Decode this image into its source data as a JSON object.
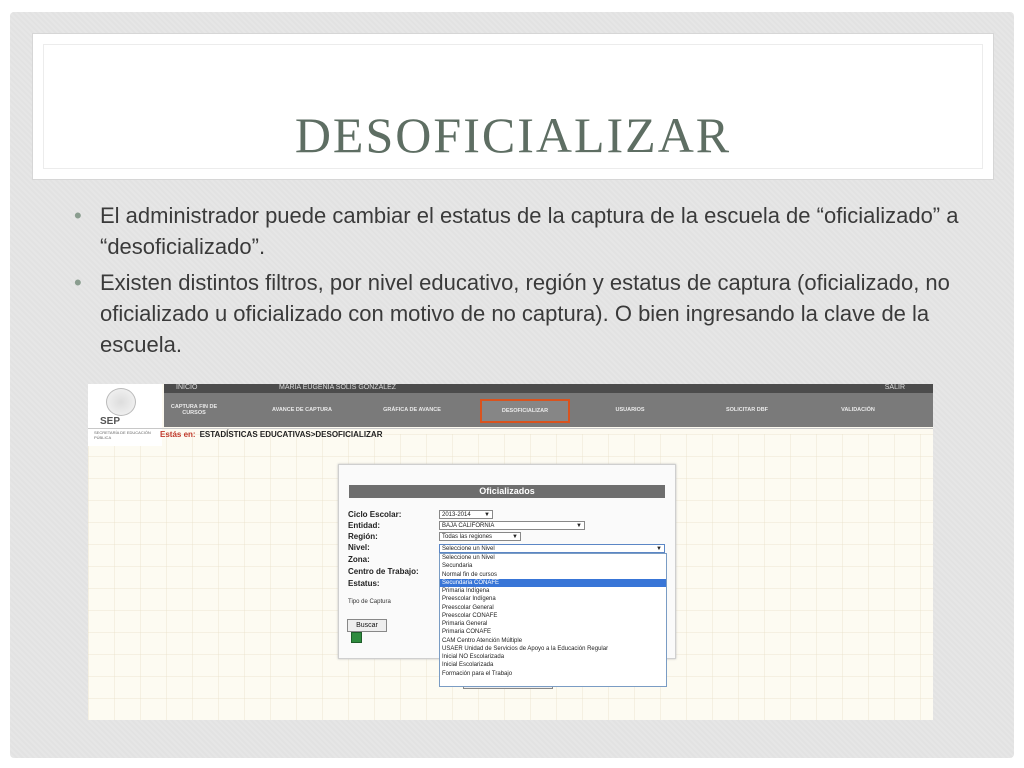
{
  "slide": {
    "title": "DESOFICIALIZAR",
    "bullets": [
      "El administrador puede cambiar el estatus de la captura de la escuela de “oficializado” a “desoficializado”.",
      "Existen distintos filtros, por nivel educativo, región y estatus de captura (oficializado, no oficializado u oficializado con motivo de no captura). O bien ingresando la clave de la escuela."
    ],
    "bullet_char": "•"
  },
  "screenshot": {
    "logo": {
      "text": "SEP",
      "sub": "SECRETARÍA DE EDUCACIÓN PÚBLICA"
    },
    "topbar": {
      "home": "INICIO",
      "user": "MARIA EUGENIA SOLIS GONZALEZ",
      "exit": "SALIR"
    },
    "nav": [
      "CAPTURA FIN DE CURSOS",
      "AVANCE DE CAPTURA",
      "GRÁFICA DE AVANCE",
      "DESOFICIALIZAR",
      "USUARIOS",
      "SOLICITAR DBF",
      "VALIDACIÓN"
    ],
    "breadcrumb": {
      "label": "Estás en:",
      "path": "ESTADÍSTICAS EDUCATIVAS>DESOFICIALIZAR"
    },
    "panel": {
      "header": "Oficializados",
      "labels": {
        "ciclo": "Ciclo Escolar:",
        "entidad": "Entidad:",
        "region": "Región:",
        "nivel": "Nivel:",
        "zona": "Zona:",
        "centro": "Centro de Trabajo:",
        "estatus": "Estatus:"
      },
      "values": {
        "ciclo": "2013-2014",
        "entidad": "BAJA CALIFORNIA",
        "region": "Todas las regiones",
        "nivel": "Seleccione un Nivel"
      },
      "tipo_captura": "Tipo de Captura",
      "buscar": "Buscar",
      "sin_registros": "Búsqueda sin registros"
    },
    "nivel_options": [
      "Seleccione un Nivel",
      "Secundaria",
      "Normal fin de cursos",
      "Secundaria CONAFE",
      "Primaria Indígena",
      "Preescolar Indígena",
      "Preescolar General",
      "Preescolar CONAFE",
      "Primaria General",
      "Primaria CONAFE",
      "CAM Centro Atención Múltiple",
      "USAER Unidad de Servicios de Apoyo a la Educación Regular",
      "Inicial NO Escolarizada",
      "Inicial Escolarizada",
      "Formación para el Trabajo"
    ],
    "highlighted_option": "Secundaria CONAFE",
    "colors": {
      "active_nav_border": "#d9531e",
      "highlight": "#3875d7"
    }
  }
}
